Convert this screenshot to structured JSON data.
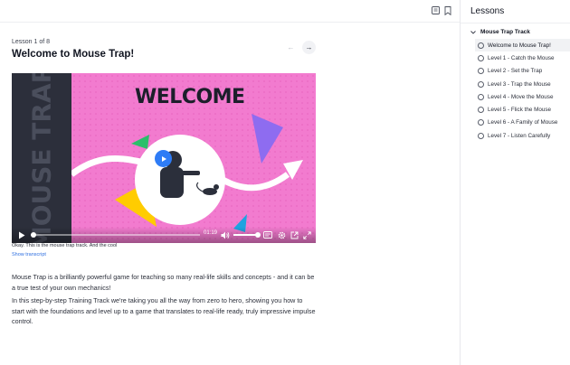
{
  "header": {
    "icons": [
      "notes-icon",
      "bookmark-icon"
    ]
  },
  "lesson": {
    "counter": "Lesson 1 of 8",
    "title": "Welcome to Mouse Trap!"
  },
  "video": {
    "banner_text": "WELCOME",
    "side_text": "MOUSE TRAP",
    "time": "01:19",
    "progress": 0.0,
    "volume": 1.0,
    "caption": "Okay. This is the mouse trap track. And the cool",
    "transcript_link": "Show transcript"
  },
  "body": {
    "paragraphs": [
      "Mouse Trap is a brilliantly powerful game for teaching so many real-life skills and concepts - and it can be a true test of your own mechanics!",
      "In this step-by-step Training Track we're taking you all the way from zero to hero, showing you how to start with the foundations and level up to a game that translates to real-life ready, truly impressive impulse control."
    ]
  },
  "sidebar": {
    "title": "Lessons",
    "track_name": "Mouse Trap Track",
    "items": [
      {
        "label": "Welcome to Mouse Trap!",
        "active": true
      },
      {
        "label": "Level 1 - Catch the Mouse",
        "active": false
      },
      {
        "label": "Level 2 - Set the Trap",
        "active": false
      },
      {
        "label": "Level 3 - Trap the Mouse",
        "active": false
      },
      {
        "label": "Level 4 - Move the Mouse",
        "active": false
      },
      {
        "label": "Level 5 - Flick the Mouse",
        "active": false
      },
      {
        "label": "Level 6 - A Family of Mouse",
        "active": false
      },
      {
        "label": "Level 7 - Listen Carefully",
        "active": false
      }
    ]
  },
  "colors": {
    "accent": "#2e7cf6",
    "video_bg": "#f06fc9",
    "link": "#2e6fe0"
  }
}
